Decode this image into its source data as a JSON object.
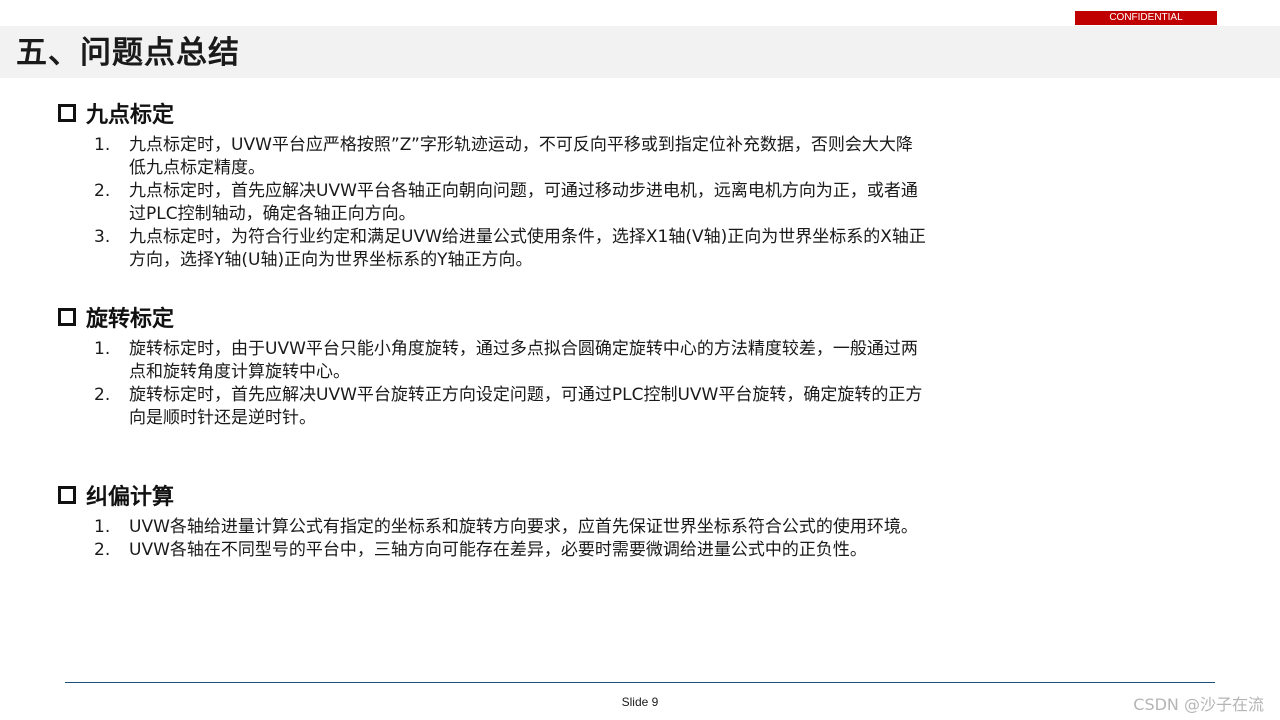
{
  "header": {
    "title": "五、问题点总结",
    "confidential_label": "CONFIDENTIAL"
  },
  "sections": [
    {
      "title": "九点标定",
      "icon": "square-bullet-icon",
      "items": [
        {
          "number": "1.",
          "text": "九点标定时，UVW平台应严格按照”Z”字形轨迹运动，不可反向平移或到指定位补充数据，否则会大大降低九点标定精度。"
        },
        {
          "number": "2.",
          "text": "九点标定时，首先应解决UVW平台各轴正向朝向问题，可通过移动步进电机，远离电机方向为正，或者通过PLC控制轴动，确定各轴正向方向。"
        },
        {
          "number": "3.",
          "text": "九点标定时，为符合行业约定和满足UVW给进量公式使用条件，选择X1轴(V轴)正向为世界坐标系的X轴正方向，选择Y轴(U轴)正向为世界坐标系的Y轴正方向。"
        }
      ]
    },
    {
      "title": "旋转标定",
      "icon": "square-bullet-icon",
      "items": [
        {
          "number": "1.",
          "text": "旋转标定时，由于UVW平台只能小角度旋转，通过多点拟合圆确定旋转中心的方法精度较差，一般通过两点和旋转角度计算旋转中心。"
        },
        {
          "number": "2.",
          "text": "旋转标定时，首先应解决UVW平台旋转正方向设定问题，可通过PLC控制UVW平台旋转，确定旋转的正方向是顺时针还是逆时针。"
        }
      ]
    },
    {
      "title": "纠偏计算",
      "icon": "square-bullet-icon",
      "items": [
        {
          "number": "1.",
          "text": "UVW各轴给进量计算公式有指定的坐标系和旋转方向要求，应首先保证世界坐标系符合公式的使用环境。"
        },
        {
          "number": "2.",
          "text": "UVW各轴在不同型号的平台中，三轴方向可能存在差异，必要时需要微调给进量公式中的正负性。"
        }
      ]
    }
  ],
  "footer": {
    "slide_number": "Slide 9",
    "watermark": "CSDN @沙子在流"
  },
  "colors": {
    "confidential_bg": "#c00000",
    "title_bar_bg": "#f2f2f2",
    "footer_line": "#1f4e79"
  }
}
